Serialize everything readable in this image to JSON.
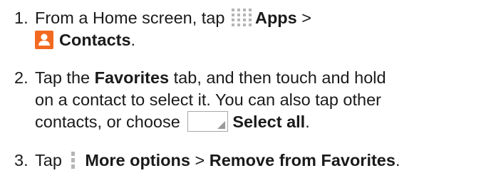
{
  "steps": [
    {
      "number": "1.",
      "t1": "From a Home screen, tap",
      "b1": "Apps",
      "t2": ">",
      "b2": "Contacts",
      "t3": "."
    },
    {
      "number": "2.",
      "t1": "Tap the",
      "b1": "Favorites",
      "t2": "tab, and then touch and hold",
      "line2": "on a contact to select it. You can also tap other",
      "t3": "contacts, or choose",
      "b2": "Select all",
      "t4": "."
    },
    {
      "number": "3.",
      "t1": "Tap",
      "b1": "More options",
      "t2": ">",
      "b2": "Remove from Favorites",
      "t3": "."
    }
  ],
  "icons": {
    "apps": "apps-grid-icon",
    "contacts": "contacts-icon",
    "select_all": "checkbox-icon",
    "more_options": "more-options-icon",
    "contacts_color": "#f26a21"
  }
}
